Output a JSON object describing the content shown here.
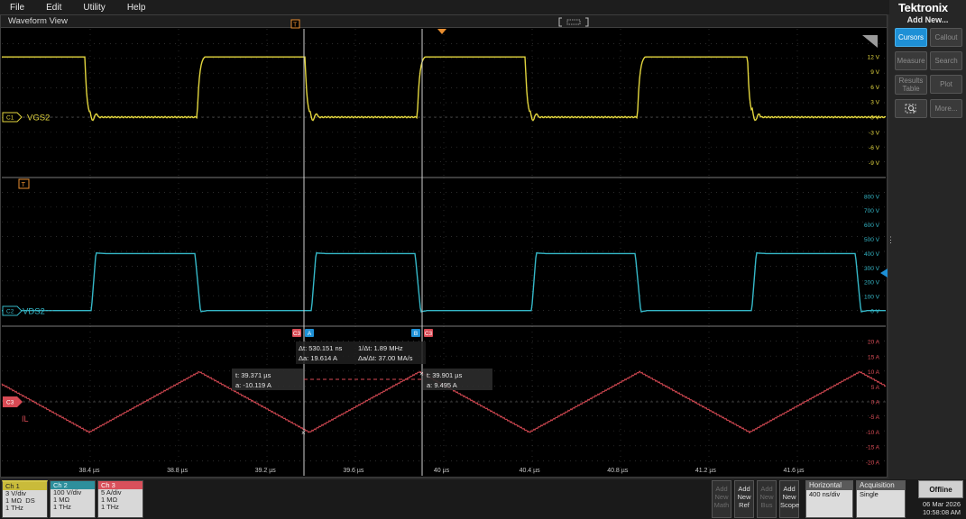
{
  "menu": [
    "File",
    "Edit",
    "Utility",
    "Help"
  ],
  "window": {
    "title": "Waveform View"
  },
  "brand": {
    "logo": "Tektronix",
    "title": "Add New..."
  },
  "right_buttons": [
    {
      "label": "Cursors",
      "state": "active"
    },
    {
      "label": "Callout",
      "state": "disabled"
    },
    {
      "label": "Measure",
      "state": "disabled"
    },
    {
      "label": "Search",
      "state": "disabled"
    },
    {
      "label": "Results Table",
      "state": "disabled"
    },
    {
      "label": "Plot",
      "state": "disabled"
    },
    {
      "label": "",
      "icon": "zoom-icon",
      "state": "normal"
    },
    {
      "label": "More...",
      "state": "disabled"
    }
  ],
  "colors": {
    "ch1": "#e3d63e",
    "ch2": "#35b8c8",
    "ch3": "#d84a54",
    "cursor": "#d0d0d0",
    "accent": "#1e90d6"
  },
  "channels": [
    {
      "id": "C1",
      "name": "VGS2",
      "badge": "Ch 1",
      "scale": "3 V/div",
      "impedance": "1 MΩ",
      "extra": "DS",
      "bandwidth": "1 THz"
    },
    {
      "id": "C2",
      "name": "VDS2",
      "badge": "Ch 2",
      "scale": "100 V/div",
      "impedance": "1 MΩ",
      "extra": "",
      "bandwidth": "1 THz"
    },
    {
      "id": "C3",
      "name": "IL",
      "badge": "Ch 3",
      "scale": "5 A/div",
      "impedance": "1 MΩ",
      "extra": "",
      "bandwidth": "1 THz"
    }
  ],
  "axis_labels": {
    "ch1": [
      "12 V",
      "9 V",
      "6 V",
      "3 V",
      "0 V",
      "-3 V",
      "-6 V",
      "-9 V"
    ],
    "ch2": [
      "800 V",
      "700 V",
      "600 V",
      "500 V",
      "400 V",
      "300 V",
      "200 V",
      "100 V",
      "0 V"
    ],
    "ch3": [
      "20 A",
      "15 A",
      "10 A",
      "5 A",
      "0 A",
      "-5 A",
      "-10 A",
      "-15 A",
      "-20 A"
    ],
    "time": [
      "38.4 µs",
      "38.8 µs",
      "39.2 µs",
      "39.6 µs",
      "40 µs",
      "40.4 µs",
      "40.8 µs",
      "41.2 µs",
      "41.6 µs"
    ]
  },
  "markers": {
    "trigger": "T",
    "ref_t": "T",
    "cursor_a": "A",
    "cursor_b": "B",
    "c3": "C3"
  },
  "cursors": {
    "delta": {
      "dt": "Δt: 530.151 ns",
      "inv_dt": "1/Δt: 1.89 MHz",
      "da": "Δa: 19.614 A",
      "da_dt": "Δa/Δt: 37.00 MA/s"
    },
    "a": {
      "t": "t: 39.371 µs",
      "a": "a: -10.119 A"
    },
    "b": {
      "t": "t: 39.901 µs",
      "a": "a: 9.495 A"
    }
  },
  "bottom": {
    "add_buttons": [
      {
        "label": "Add New Math",
        "state": "disabled"
      },
      {
        "label": "Add New Ref",
        "state": "enabled"
      },
      {
        "label": "Add New Bus",
        "state": "disabled"
      },
      {
        "label": "Add New Scope",
        "state": "enabled"
      }
    ],
    "horizontal": {
      "title": "Horizontal",
      "value": "400 ns/div"
    },
    "acquisition": {
      "title": "Acquisition",
      "value": "Single"
    },
    "status": "Offline",
    "date": "06 Mar 2026",
    "time": "10:58:08 AM"
  }
}
